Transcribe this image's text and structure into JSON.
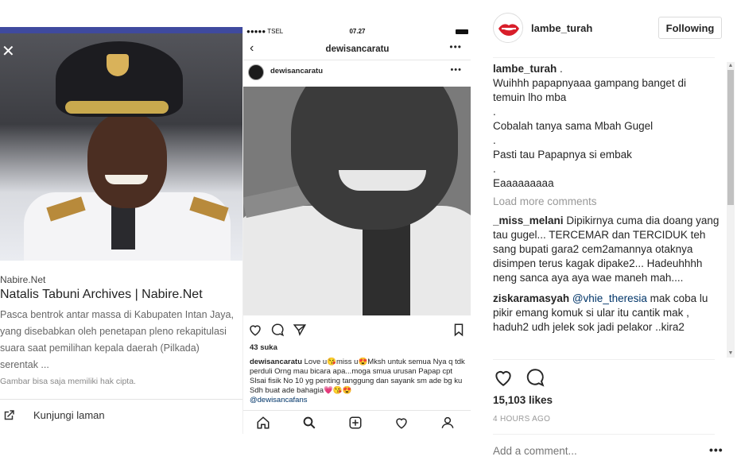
{
  "left_card": {
    "source": "Nabire.Net",
    "title": "Natalis Tabuni Archives | Nabire.Net",
    "description": "Pasca bentrok antar massa di Kabupaten Intan Jaya, yang disebabkan oleh penetapan pleno rekapitulasi suara saat pemilihan kepala daerah (Pilkada) serentak ...",
    "copyright_note": "Gambar bisa saja memiliki hak cipta.",
    "visit_label": "Kunjungi laman",
    "close_icon": "close-icon",
    "visit_icon": "open-external-icon"
  },
  "phone": {
    "status": {
      "carrier": "●●●●● TSEL",
      "time": "07.27"
    },
    "header_title": "dewisancaratu",
    "back_icon": "chevron-left-icon",
    "post_username": "dewisancaratu",
    "likes": "43 suka",
    "caption": {
      "username": "dewisancaratu",
      "text": "Love u😘miss u😍Mksh untuk semua Nya q tdk perduli Orng mau bicara apa...moga smua urusan Papap cpt Slsai fisik No 10 yg penting tanggung dan sayank sm ade bg ku Sdh buat ade bahagia💗😘😍",
      "mention": "@dewisancafans"
    }
  },
  "right": {
    "username": "lambe_turah",
    "follow_label": "Following",
    "caption_user": "lambe_turah",
    "caption_head": ".",
    "caption_lines": [
      "Wuihhh papapnyaaa gampang banget di temuin lho mba",
      ".",
      "Cobalah tanya sama Mbah Gugel",
      ".",
      "Pasti tau Papapnya si embak",
      ".",
      "Eaaaaaaaaa"
    ],
    "load_more": "Load more comments",
    "comments": [
      {
        "user": "_miss_melani",
        "text": "Dipikirnya cuma dia doang yang tau gugel... TERCEMAR dan TERCIDUK teh sang bupati gara2 cem2amannya otaknya disimpen terus kagak dipake2... Hadeuhhhh neng sanca aya aya wae maneh mah...."
      },
      {
        "user": "ziskaramasyah",
        "mention": "@vhie_theresia",
        "text": "mak coba lu pikir emang komuk si ular itu cantik mak , haduh2 udh jelek sok jadi pelakor ..kira2"
      }
    ],
    "likes": "15,103 likes",
    "time": "4 HOURS AGO",
    "comment_placeholder": "Add a comment...",
    "more": "•••"
  },
  "colors": {
    "accent_bar": "#3f4a9e",
    "mention": "#003569",
    "muted": "#999999"
  }
}
